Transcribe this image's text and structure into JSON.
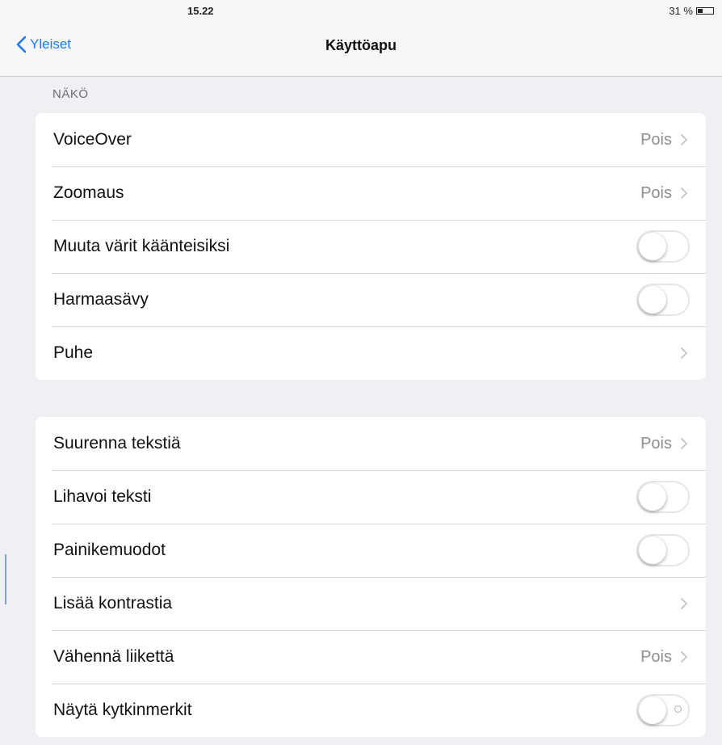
{
  "status_bar": {
    "time": "15.22",
    "battery_percent": "31 %",
    "battery_level": 0.31
  },
  "nav": {
    "back_label": "Yleiset",
    "title": "Käyttöapu"
  },
  "section_vision": {
    "header": "NÄKÖ",
    "rows": [
      {
        "label": "VoiceOver",
        "value": "Pois",
        "control": "chevron"
      },
      {
        "label": "Zoomaus",
        "value": "Pois",
        "control": "chevron"
      },
      {
        "label": "Muuta värit käänteisiksi",
        "control": "toggle",
        "on": false
      },
      {
        "label": "Harmaasävy",
        "control": "toggle",
        "on": false
      },
      {
        "label": "Puhe",
        "control": "chevron"
      }
    ]
  },
  "section_text": {
    "rows": [
      {
        "label": "Suurenna tekstiä",
        "value": "Pois",
        "control": "chevron"
      },
      {
        "label": "Lihavoi teksti",
        "control": "toggle",
        "on": false
      },
      {
        "label": "Painikemuodot",
        "control": "toggle",
        "on": false
      },
      {
        "label": "Lisää kontrastia",
        "control": "chevron"
      },
      {
        "label": "Vähennä liikettä",
        "value": "Pois",
        "control": "chevron"
      },
      {
        "label": "Näytä kytkinmerkit",
        "control": "toggle",
        "on": false
      }
    ]
  },
  "colors": {
    "accent": "#1a7cf2",
    "background": "#efeff4",
    "secondary_text": "#8e8e93"
  },
  "icons": {
    "back": "chevron-left-icon",
    "disclosure": "chevron-right-icon",
    "battery": "battery-icon"
  }
}
